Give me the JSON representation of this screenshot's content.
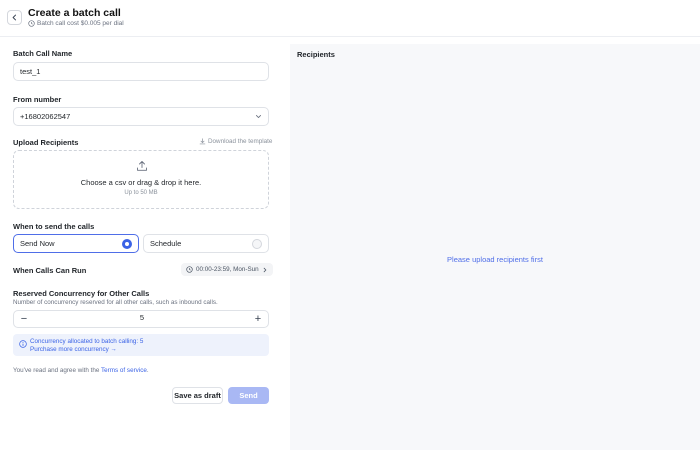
{
  "header": {
    "title": "Create a batch call",
    "subtitle": "Batch call cost $0.005 per dial",
    "back_icon": "chevron-left-icon",
    "cost_icon": "clock-icon"
  },
  "form": {
    "batch_name": {
      "label": "Batch Call Name",
      "value": "test_1"
    },
    "from_number": {
      "label": "From number",
      "value": "+16802062547"
    },
    "upload": {
      "label": "Upload Recipients",
      "template_link": "Download the template",
      "drop_main": "Choose a csv or drag & drop it here.",
      "drop_sub": "Up to 50 MB"
    },
    "when": {
      "label": "When to send the calls",
      "options": [
        {
          "label": "Send Now",
          "selected": true
        },
        {
          "label": "Schedule",
          "selected": false
        }
      ]
    },
    "run_window": {
      "label": "When Calls Can Run",
      "value": "00:00-23:59, Mon-Sun"
    },
    "concurrency": {
      "label": "Reserved Concurrency for Other Calls",
      "description": "Number of concurrency reserved for all other calls, such as inbound calls.",
      "value": "5",
      "minus": "−",
      "plus": "+"
    },
    "info": {
      "line1": "Concurrency allocated to batch calling: 5",
      "line2": "Purchase more concurrency →"
    },
    "terms": {
      "prefix": "You've read and agree with the ",
      "link": "Terms of service",
      "suffix": "."
    },
    "buttons": {
      "draft": "Save as draft",
      "send": "Send"
    }
  },
  "recipients": {
    "title": "Recipients",
    "empty": "Please upload recipients first"
  },
  "colors": {
    "accent": "#3b63e6",
    "send_disabled": "#a9b8f4",
    "info_bg": "#eef2fc",
    "panel_bg": "#f7f8fa"
  }
}
